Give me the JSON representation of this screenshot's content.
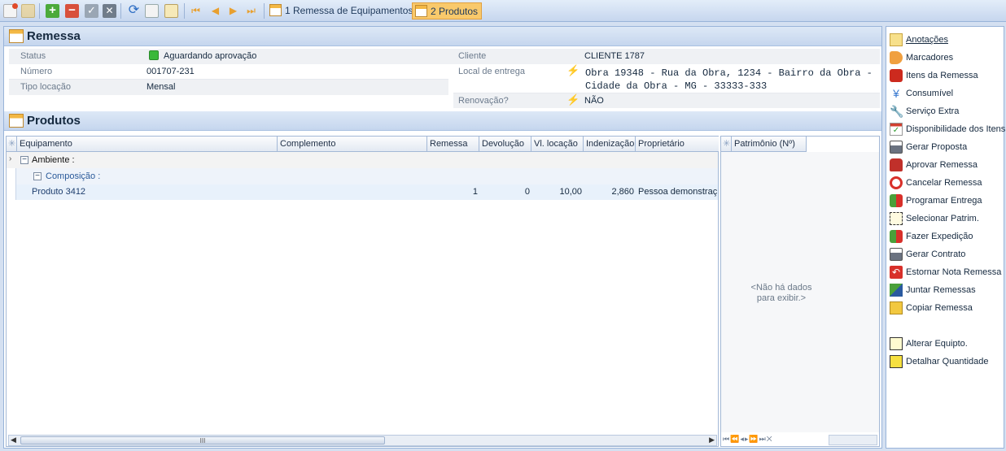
{
  "toolbar": {
    "tab1_label": "1 Remessa de Equipamentos",
    "tab2_label": "2 Produtos"
  },
  "remessa": {
    "title": "Remessa",
    "status_label": "Status",
    "status_value": "Aguardando aprovação",
    "numero_label": "Número",
    "numero_value": "001707-231",
    "tipo_label": "Tipo locação",
    "tipo_value": "Mensal",
    "cliente_label": "Cliente",
    "cliente_value": "CLIENTE  1787",
    "local_label": "Local de entrega",
    "local_value_line1": "Obra 19348 - Rua da Obra, 1234 - Bairro da Obra -",
    "local_value_line2": "Cidade da Obra - MG - 33333-333",
    "renov_label": "Renovação?",
    "renov_value": "NÃO"
  },
  "produtos": {
    "title": "Produtos",
    "columns": [
      "Equipamento",
      "Complemento",
      "Remessa",
      "Devolução",
      "Vl. locação",
      "Indenização",
      "Proprietário"
    ],
    "group1": "Ambiente :",
    "group2": "Composição :",
    "row": {
      "equipamento": "Produto 3412",
      "remessa": "1",
      "devolucao": "0",
      "vl_locacao": "10,00",
      "indenizacao": "2,860",
      "proprietario": "Pessoa demonstraç"
    },
    "patrimonio_header": "Patrimônio (Nº)",
    "no_data_line1": "<Não há dados",
    "no_data_line2": "para exibir.>",
    "scroll_grip": "III"
  },
  "sidebar": {
    "items": [
      "Anotações",
      "Marcadores",
      "Itens da Remessa",
      "Consumível",
      "Serviço Extra",
      "Disponibilidade dos Itens",
      "Gerar Proposta",
      "Aprovar Remessa",
      "Cancelar Remessa",
      "Programar Entrega",
      "Selecionar Patrim.",
      "Fazer Expedição",
      "Gerar Contrato",
      "Estornar Nota Remessa",
      "Juntar Remessas",
      "Copiar Remessa",
      "Alterar Equipto.",
      "Detalhar Quantidade"
    ]
  }
}
